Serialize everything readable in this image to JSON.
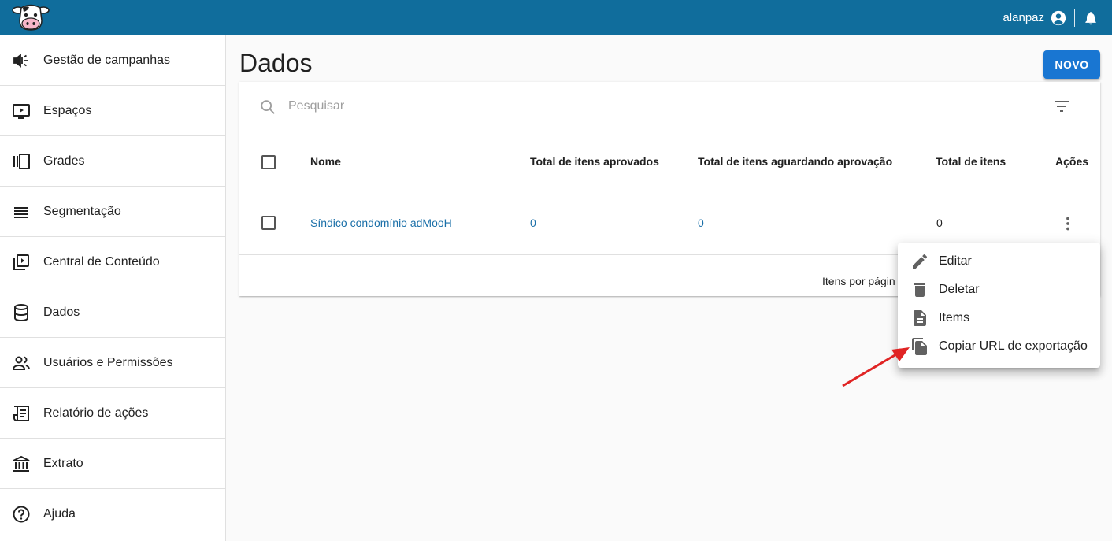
{
  "topbar": {
    "username": "alanpaz",
    "logo_icon": "cow-logo-icon",
    "user_icon": "account-circle-icon",
    "bell_icon": "bell-icon",
    "background": "#106d9c"
  },
  "sidebar": {
    "items": [
      {
        "label": "Gestão de campanhas",
        "icon": "megaphone-icon"
      },
      {
        "label": "Espaços",
        "icon": "screen-play-icon"
      },
      {
        "label": "Grades",
        "icon": "carousel-icon"
      },
      {
        "label": "Segmentação",
        "icon": "list-lines-icon"
      },
      {
        "label": "Central de Conteúdo",
        "icon": "video-library-icon"
      },
      {
        "label": "Dados",
        "icon": "database-icon"
      },
      {
        "label": "Usuários e Permissões",
        "icon": "people-icon"
      },
      {
        "label": "Relatório de ações",
        "icon": "receipt-icon"
      },
      {
        "label": "Extrato",
        "icon": "bank-icon"
      },
      {
        "label": "Ajuda",
        "icon": "help-circle-icon"
      }
    ]
  },
  "main": {
    "title": "Dados",
    "new_button": "NOVO",
    "search_placeholder": "Pesquisar",
    "table": {
      "headers": [
        "Nome",
        "Total de itens aprovados",
        "Total de itens aguardando aprovação",
        "Total de itens",
        "Ações"
      ],
      "rows": [
        {
          "nome": "Síndico condomínio adMooH",
          "aprovados": "0",
          "aguardando": "0",
          "total": "0"
        }
      ],
      "footer": "Itens por págin"
    }
  },
  "context_menu": {
    "items": [
      {
        "label": "Editar",
        "icon": "pencil-icon"
      },
      {
        "label": "Deletar",
        "icon": "trash-icon"
      },
      {
        "label": "Items",
        "icon": "document-icon"
      },
      {
        "label": "Copiar URL de exportação",
        "icon": "file-copy-icon"
      }
    ]
  },
  "colors": {
    "accent": "#1976d2",
    "link": "#1a6fa8",
    "annotation_arrow": "#e02424"
  }
}
